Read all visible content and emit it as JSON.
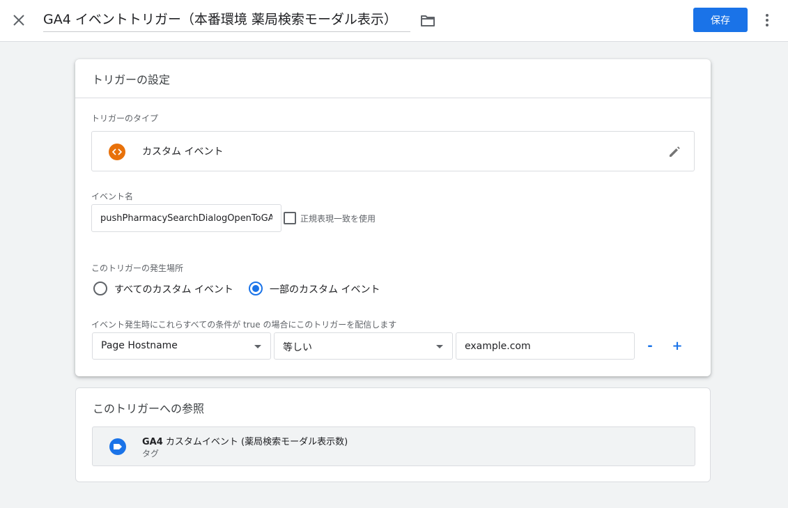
{
  "header": {
    "close_icon": "close-icon",
    "title": "GA4 イベントトリガー（本番環境 薬局検索モーダル表示）",
    "folder_icon": "folder-icon",
    "save_label": "保存",
    "more_icon": "more-vert-icon"
  },
  "trigger_config": {
    "heading": "トリガーの設定",
    "type_label": "トリガーのタイプ",
    "type_name": "カスタム イベント",
    "type_icon": "custom-event-icon",
    "edit_icon": "pencil-icon",
    "event_name_label": "イベント名",
    "event_name_value": "pushPharmacySearchDialogOpenToGA",
    "regex_checkbox_label": "正規表現一致を使用",
    "regex_checked": false,
    "fire_on_label": "このトリガーの発生場所",
    "fire_on_options": [
      {
        "label": "すべてのカスタム イベント",
        "selected": false
      },
      {
        "label": "一部のカスタム イベント",
        "selected": true
      }
    ],
    "condition_label": "イベント発生時にこれらすべての条件が true の場合にこのトリガーを配信します",
    "condition": {
      "variable": "Page Hostname",
      "operator": "等しい",
      "value": "example.com"
    },
    "remove_label": "-",
    "add_label": "+"
  },
  "references": {
    "heading": "このトリガーへの参照",
    "items": [
      {
        "name_bold": "GA4",
        "name_rest": " カスタムイベント (薬局検索モーダル表示数)",
        "type": "タグ",
        "icon": "tag-icon"
      }
    ]
  },
  "colors": {
    "accent": "#1a73e8",
    "custom_event_orange": "#e8710a",
    "background": "#f1f3f4"
  }
}
